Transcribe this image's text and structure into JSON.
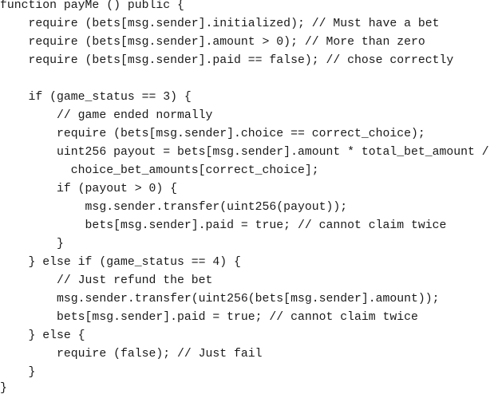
{
  "code": {
    "lines": [
      "function payMe () public {",
      "    require (bets[msg.sender].initialized); // Must have a bet",
      "    require (bets[msg.sender].amount > 0); // More than zero",
      "    require (bets[msg.sender].paid == false); // chose correctly",
      "",
      "    if (game_status == 3) {",
      "        // game ended normally",
      "        require (bets[msg.sender].choice == correct_choice);",
      "        uint256 payout = bets[msg.sender].amount * total_bet_amount /",
      "          choice_bet_amounts[correct_choice];",
      "        if (payout > 0) {",
      "            msg.sender.transfer(uint256(payout));",
      "            bets[msg.sender].paid = true; // cannot claim twice",
      "        }",
      "    } else if (game_status == 4) {",
      "        // Just refund the bet",
      "        msg.sender.transfer(uint256(bets[msg.sender].amount));",
      "        bets[msg.sender].paid = true; // cannot claim twice",
      "    } else {",
      "        require (false); // Just fail",
      "    }",
      "}"
    ]
  }
}
